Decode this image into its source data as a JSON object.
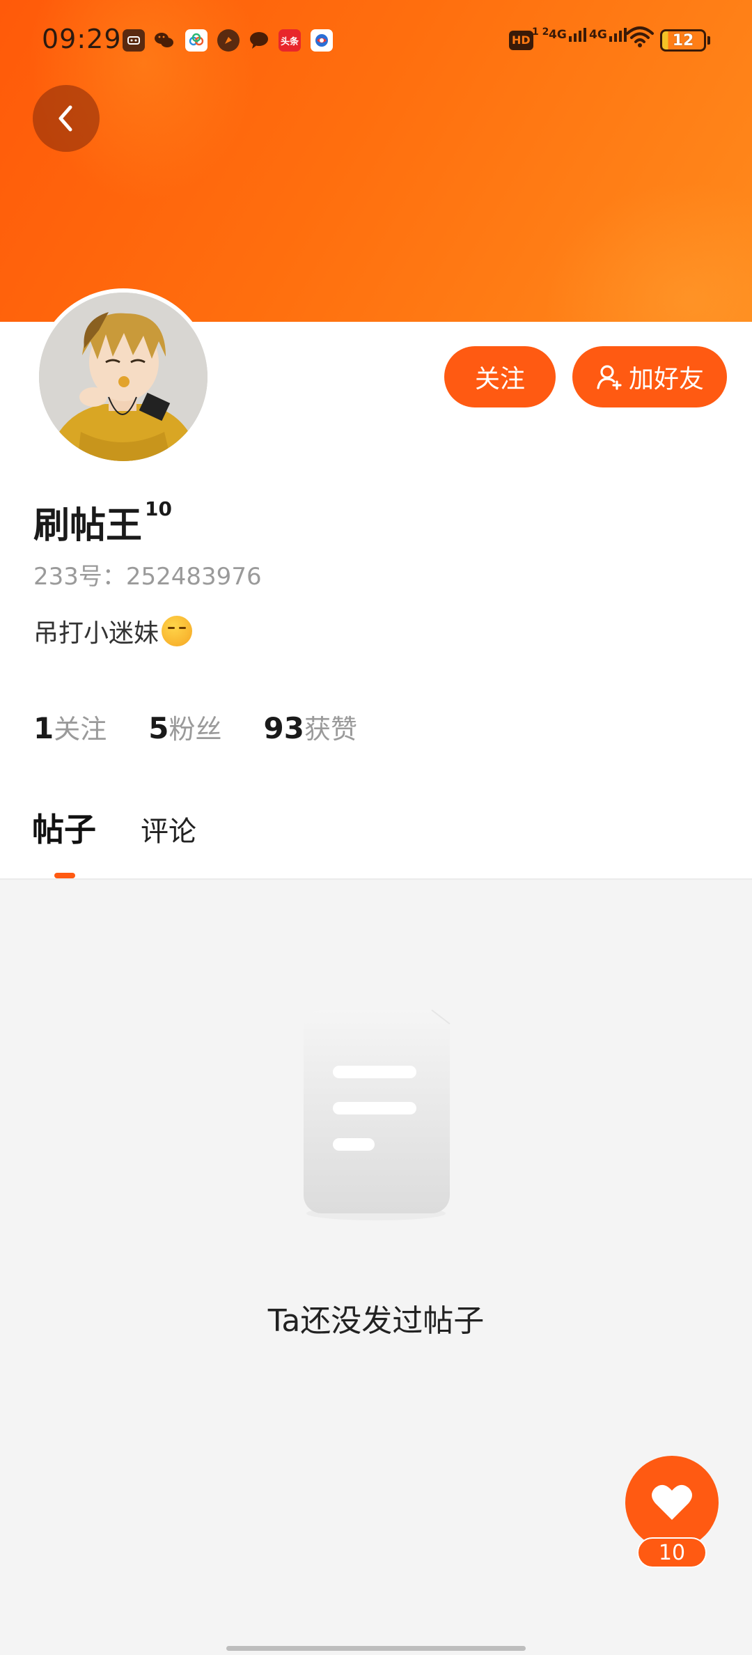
{
  "status_bar": {
    "time": "09:29",
    "battery": "12",
    "network_1": "4G",
    "network_2": "4G",
    "hd_label": "HD",
    "hd_sub": "1 2",
    "notification_icons": [
      "gamepad-app-icon",
      "wechat-icon",
      "cloud-app-icon",
      "compass-app-icon",
      "chat-bubble-icon",
      "toutiao-news-icon",
      "browser-app-icon"
    ],
    "toutiao_label": "头条"
  },
  "header": {
    "gradient_colors": [
      "#ff5a0a",
      "#ff8a1c"
    ]
  },
  "profile": {
    "nickname": "刷帖王",
    "level": "10",
    "uid": "233号：252483976",
    "bio": "吊打小迷妹"
  },
  "actions": {
    "follow_label": "关注",
    "add_friend_label": "加好友"
  },
  "stats": [
    {
      "num": "1",
      "label": "关注"
    },
    {
      "num": "5",
      "label": "粉丝"
    },
    {
      "num": "93",
      "label": "获赞"
    }
  ],
  "tabs": [
    {
      "label": "帖子",
      "active": true
    },
    {
      "label": "评论",
      "active": false
    }
  ],
  "empty_state": {
    "message": "Ta还没发过帖子"
  },
  "like": {
    "count": "10"
  },
  "colors": {
    "accent": "#ff5a12",
    "background": "#f4f4f4"
  }
}
